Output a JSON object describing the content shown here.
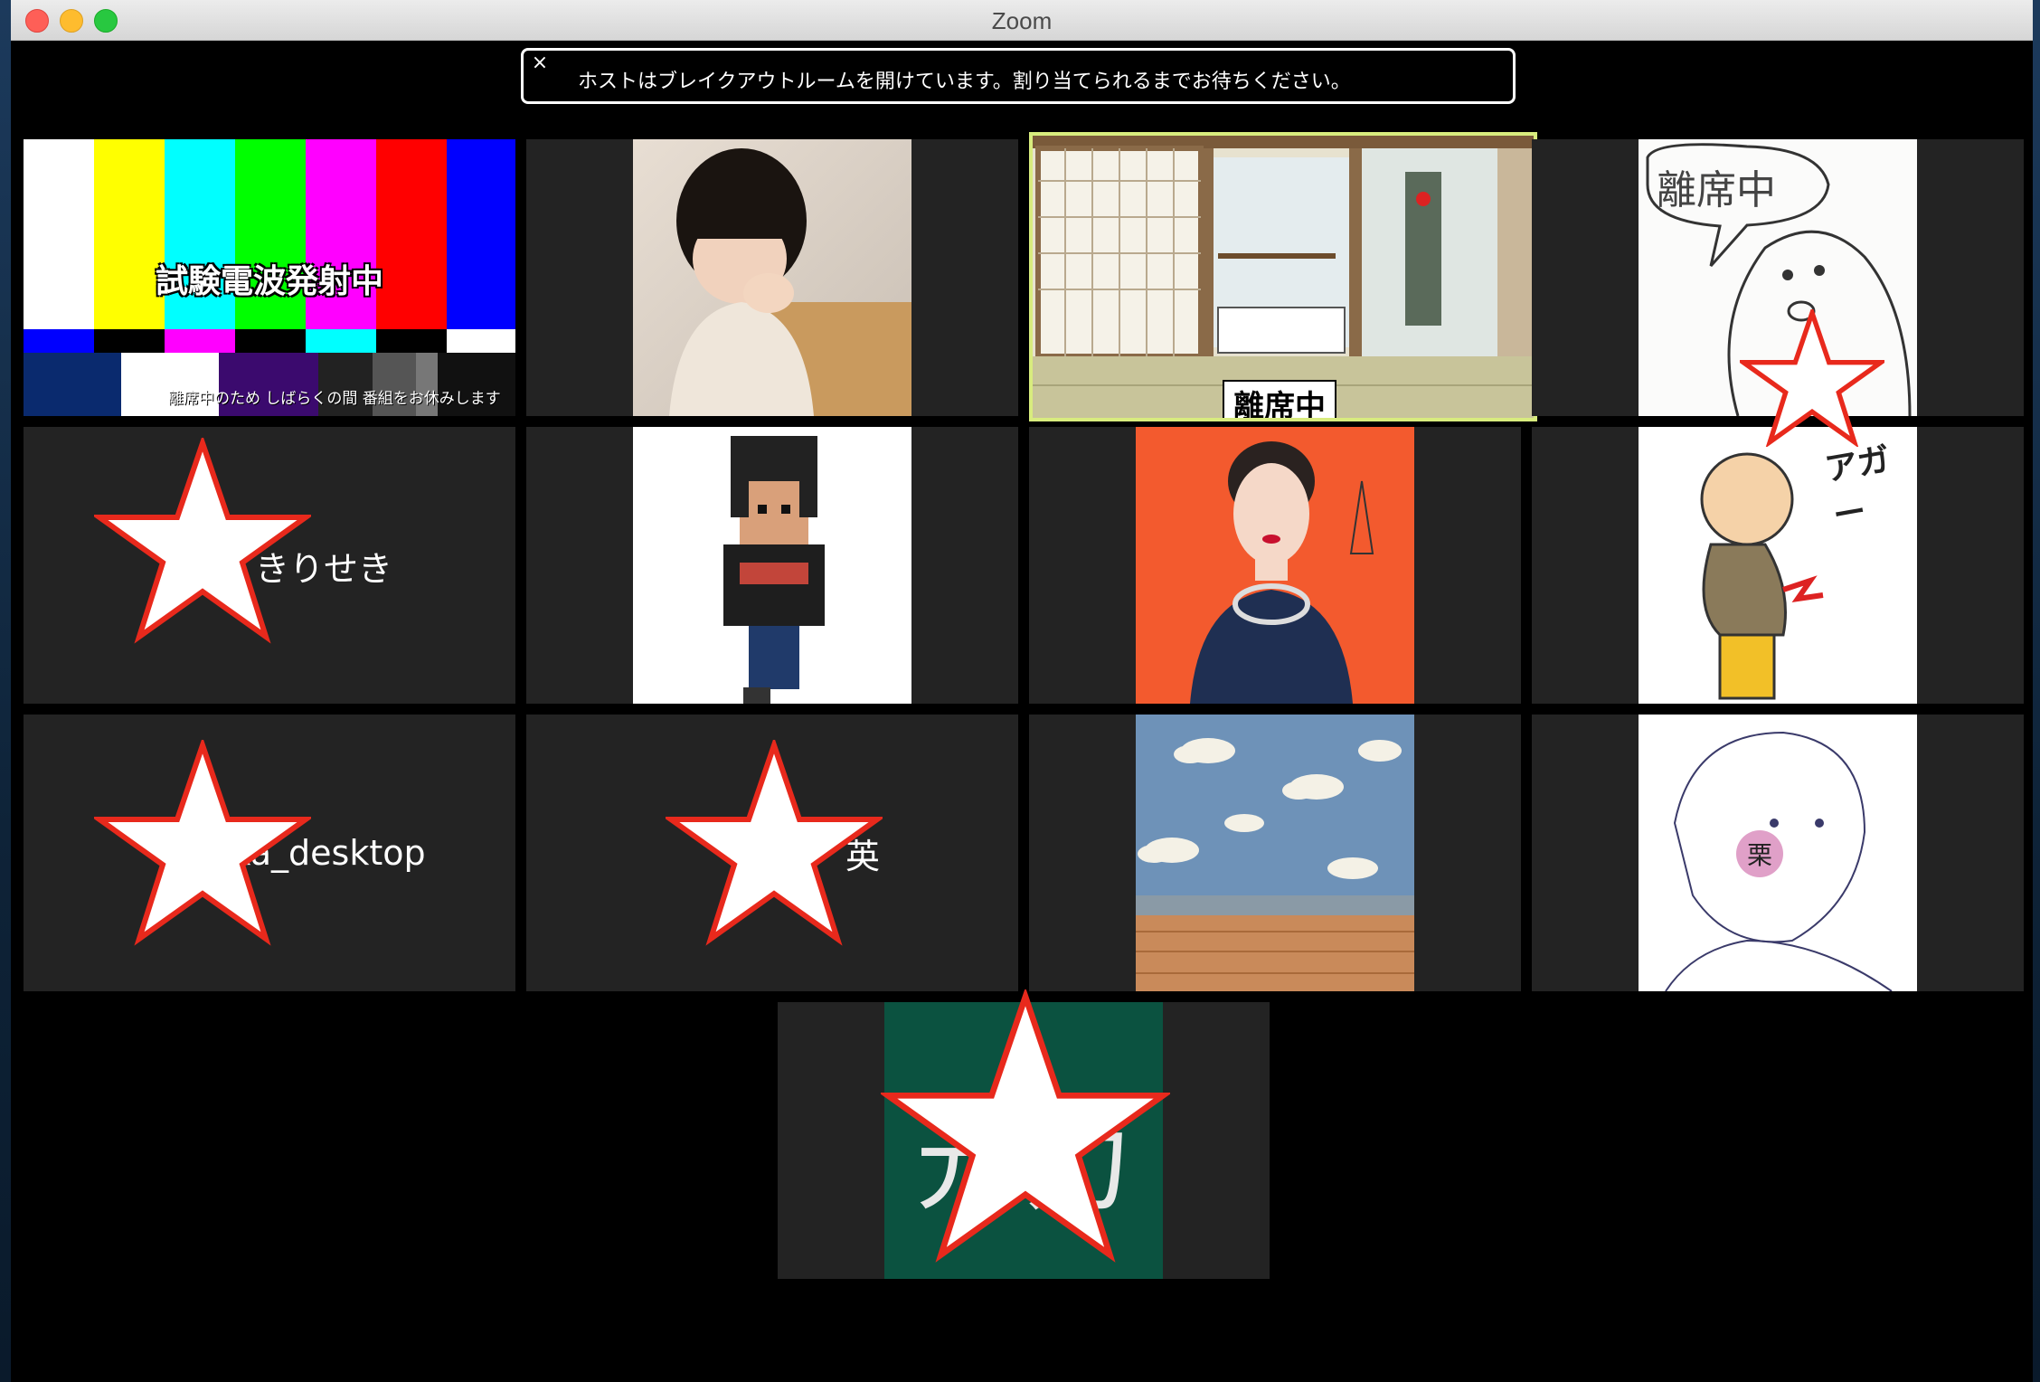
{
  "window": {
    "title": "Zoom"
  },
  "banner": {
    "close_glyph": "×",
    "text": "ホストはブレイクアウトルームを開けています。割り当てられるまでお待ちください。"
  },
  "tiles": {
    "test_pattern": {
      "caption": "試験電波発射中",
      "subcaption": "離席中のため しばらくの間 番組をお休みします"
    },
    "room": {
      "label": "離席中"
    },
    "sketch": {
      "text": "離席中"
    },
    "manga": {
      "sfx": "アガー"
    },
    "name_kiriseki": {
      "name": "きりせき"
    },
    "name_desktop": {
      "name": "ka_desktop"
    },
    "name_third": {
      "name": "英"
    },
    "line_art": {
      "badge": "栗"
    },
    "green_board": {
      "text": "元力"
    }
  },
  "colors": {
    "tile_bg": "#232323",
    "active_border": "#d8ec7e",
    "star_stroke": "#e8291c"
  }
}
